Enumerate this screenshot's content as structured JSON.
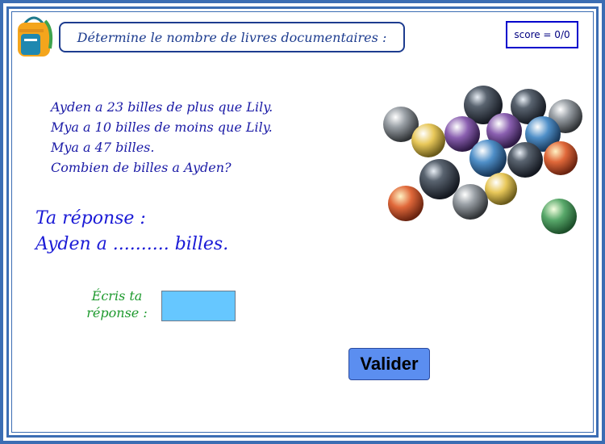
{
  "title": "Détermine le nombre de livres documentaires :",
  "score": "score = 0/0",
  "statement": {
    "line1": "Ayden a 23 billes de plus que Lily.",
    "line2": "Mya a 10 billes de moins que Lily.",
    "line3": "Mya a 47 billes.",
    "line4": "Combien de billes a Ayden?"
  },
  "answer": {
    "label_line1": "Ta réponse :",
    "label_line2": "Ayden a .......... billes."
  },
  "input": {
    "label": "Écris ta réponse :",
    "value": ""
  },
  "buttons": {
    "validate": "Valider"
  },
  "icons": {
    "logo": "school-backpack-icon",
    "illustration": "marbles-image"
  },
  "colors": {
    "frame": "#3b6db3",
    "title": "#1d3c8f",
    "statement": "#1a1aa6",
    "answer": "#1a1ad6",
    "input_label": "#1e9a2e",
    "input_bg": "#66c7ff",
    "button_bg": "#5b8ef0"
  }
}
